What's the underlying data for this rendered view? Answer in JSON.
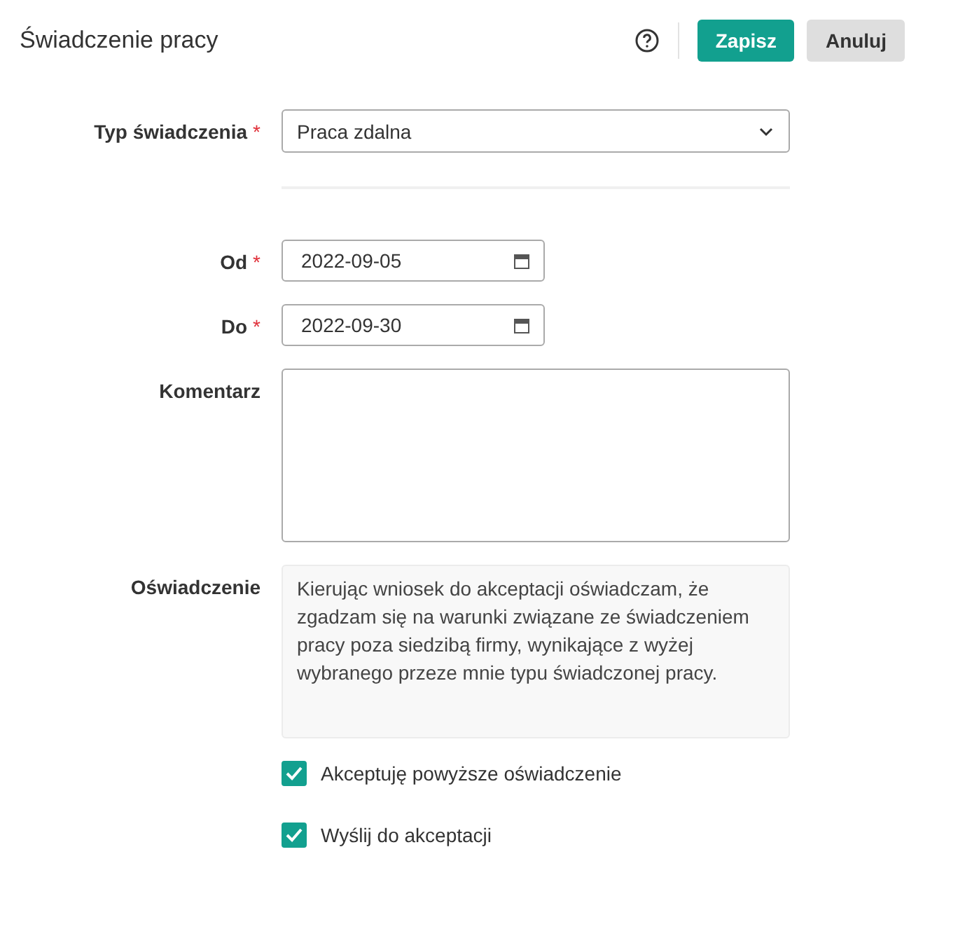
{
  "header": {
    "title": "Świadczenie pracy",
    "buttons": [
      {
        "label": "Zapisz",
        "kind": "primary"
      },
      {
        "label": "Anuluj",
        "kind": "secondary"
      }
    ]
  },
  "fields": [
    {
      "kind": "select",
      "label": "Typ świadczenia",
      "required_mark": "*",
      "value": "Praca zdalna"
    },
    {
      "kind": "divider"
    },
    {
      "kind": "date",
      "label": "Od",
      "required_mark": "*",
      "value": "2022-09-05"
    },
    {
      "kind": "date",
      "label": "Do",
      "required_mark": "*",
      "value": "2022-09-30"
    },
    {
      "kind": "textarea",
      "label": "Komentarz"
    },
    {
      "kind": "statement",
      "label": "Oświadczenie",
      "text": "Kierując wniosek do akceptacji oświadczam, że zgadzam się na warunki związane ze świadczeniem pracy poza siedzibą firmy, wynikające z wyżej wybranego przeze mnie typu świadczonej pracy."
    }
  ],
  "checkboxes": [
    {
      "label": "Akceptuję powyższe oświadczenie",
      "checked": true
    },
    {
      "label": "Wyślij do akceptacji",
      "checked": true
    }
  ]
}
